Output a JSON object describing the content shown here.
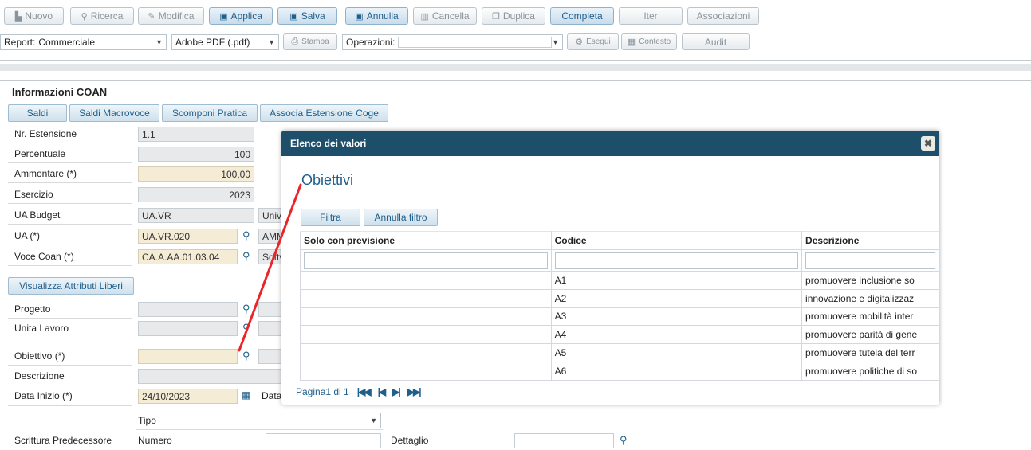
{
  "toolbar": {
    "buttons": [
      {
        "label": "Nuovo",
        "icon": "file-icon"
      },
      {
        "label": "Ricerca",
        "icon": "search-icon"
      },
      {
        "label": "Modifica",
        "icon": "pencil-icon"
      },
      {
        "label": "Applica",
        "icon": "save-icon"
      },
      {
        "label": "Salva",
        "icon": "save-check-icon"
      },
      {
        "label": "Annulla",
        "icon": "save-cancel-icon"
      },
      {
        "label": "Cancella",
        "icon": "trash-icon"
      },
      {
        "label": "Duplica",
        "icon": "copy-icon"
      },
      {
        "label": "Completa"
      },
      {
        "label": "Iter"
      },
      {
        "label": "Associazioni"
      }
    ],
    "report_label": "Report:",
    "report_value": "Commerciale",
    "format_value": "Adobe PDF (.pdf)",
    "print_label": "Stampa",
    "operations_label": "Operazioni:",
    "operations_value": "",
    "run_label": "Esegui",
    "context_label": "Contesto",
    "audit_label": "Audit"
  },
  "section": {
    "title": "Informazioni COAN",
    "tabs": [
      "Saldi",
      "Saldi Macrovoce",
      "Scomponi Pratica",
      "Associa Estensione Coge"
    ]
  },
  "form": {
    "nr_estensione": {
      "label": "Nr. Estensione",
      "value": "1.1"
    },
    "percentuale": {
      "label": "Percentuale",
      "value": "100"
    },
    "ammontare": {
      "label": "Ammontare (*)",
      "value": "100,00"
    },
    "esercizio": {
      "label": "Esercizio",
      "value": "2023"
    },
    "ua_budget": {
      "label": "UA Budget",
      "value": "UA.VR",
      "desc": "Univ"
    },
    "ua": {
      "label": "UA (*)",
      "value": "UA.VR.020",
      "desc": "AMM"
    },
    "voce_coan": {
      "label": "Voce Coan (*)",
      "value": "CA.A.AA.01.03.04",
      "desc": "Softv"
    },
    "attributi_button": "Visualizza Attributi Liberi",
    "progetto": {
      "label": "Progetto",
      "value": ""
    },
    "unita_lavoro": {
      "label": "Unita Lavoro",
      "value": ""
    },
    "obiettivo": {
      "label": "Obiettivo (*)",
      "value": ""
    },
    "descrizione": {
      "label": "Descrizione",
      "value": ""
    },
    "data_inizio": {
      "label": "Data Inizio (*)",
      "value": "24/10/2023",
      "next_label": "Data"
    },
    "tipo": {
      "label": "Tipo",
      "value": ""
    },
    "scrittura": {
      "label": "Scrittura Predecessore",
      "numero_label": "Numero",
      "numero_value": "",
      "dettaglio_label": "Dettaglio",
      "dettaglio_value": ""
    }
  },
  "dialog": {
    "header": "Elenco dei valori",
    "title": "Obiettivi",
    "filter_button": "Filtra",
    "clear_filter_button": "Annulla filtro",
    "columns": [
      "Solo con previsione",
      "Codice",
      "Descrizione"
    ],
    "rows": [
      {
        "previsione": "",
        "codice": "A1",
        "descrizione": "promuovere inclusione so"
      },
      {
        "previsione": "",
        "codice": "A2",
        "descrizione": "innovazione e digitalizzaz"
      },
      {
        "previsione": "",
        "codice": "A3",
        "descrizione": "promuovere mobilità inter"
      },
      {
        "previsione": "",
        "codice": "A4",
        "descrizione": "promuovere parità di gene"
      },
      {
        "previsione": "",
        "codice": "A5",
        "descrizione": "promuovere tutela del terr"
      },
      {
        "previsione": "",
        "codice": "A6",
        "descrizione": "promuovere politiche di so"
      }
    ],
    "pager": "Pagina1 di 1"
  },
  "colors": {
    "accent": "#1f5f8b",
    "header": "#1d4f6b",
    "required_bg": "#f5ecd6",
    "annotation": "#e8262a"
  }
}
